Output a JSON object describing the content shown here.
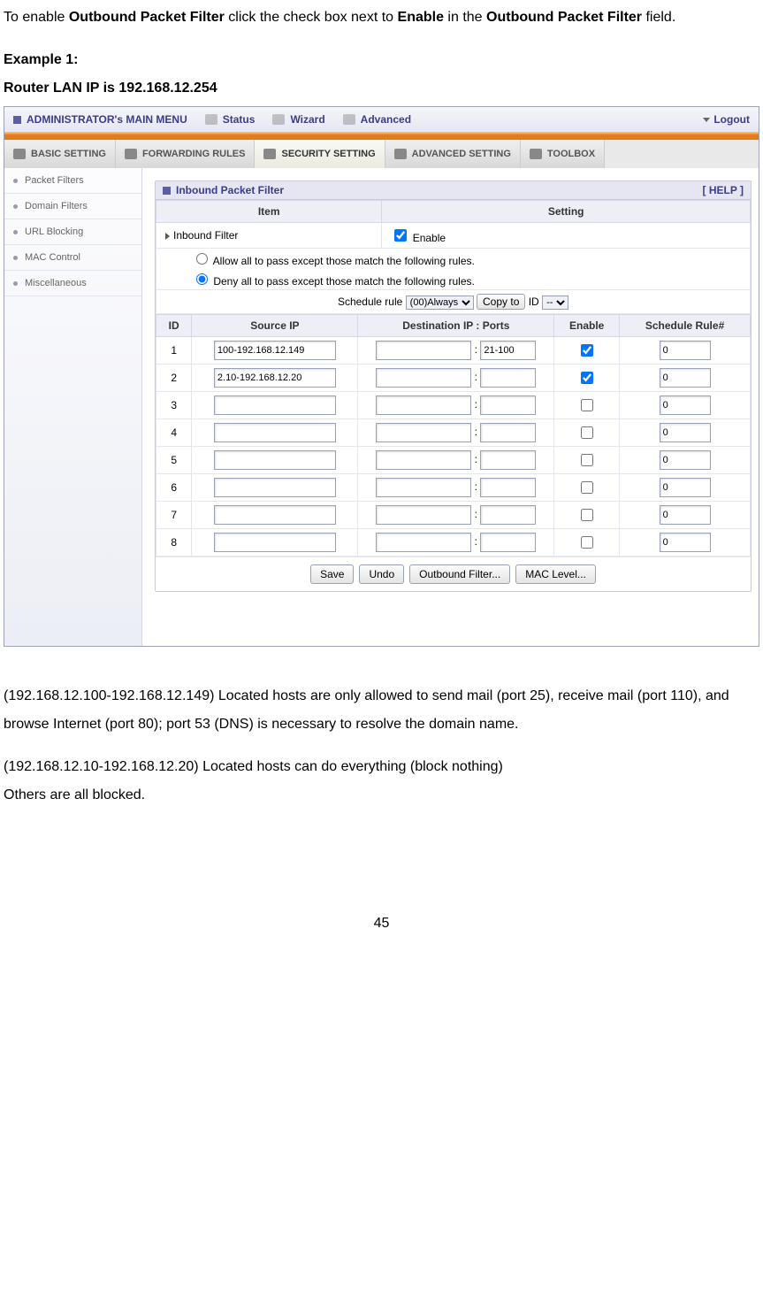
{
  "intro": {
    "prefix": "To enable ",
    "bold1": "Outbound Packet Filter",
    "mid1": " click the check box next to ",
    "bold2": "Enable",
    "mid2": " in the ",
    "bold3": "Outbound Packet Filter",
    "suffix": " field."
  },
  "heading": {
    "example_label": "Example 1:",
    "router_line": "Router LAN IP is 192.168.12.254"
  },
  "topnav": {
    "main": "ADMINISTRATOR's MAIN MENU",
    "status": "Status",
    "wizard": "Wizard",
    "advanced": "Advanced",
    "logout": "Logout"
  },
  "tabs": {
    "basic": "BASIC SETTING",
    "forwarding": "FORWARDING RULES",
    "security": "SECURITY SETTING",
    "advanced": "ADVANCED SETTING",
    "toolbox": "TOOLBOX"
  },
  "sidebar": {
    "items": [
      {
        "label": "Packet Filters"
      },
      {
        "label": "Domain Filters"
      },
      {
        "label": "URL Blocking"
      },
      {
        "label": "MAC Control"
      },
      {
        "label": "Miscellaneous"
      }
    ]
  },
  "panel": {
    "title": "Inbound Packet Filter",
    "help": "[ HELP ]",
    "th_item": "Item",
    "th_setting": "Setting",
    "row_inbound": "Inbound Filter",
    "enable_label": "Enable",
    "radio_allow": "Allow all to pass except those match the following rules.",
    "radio_deny": "Deny all to pass except those match the following rules.",
    "schedule_label": "Schedule rule",
    "schedule_option": "(00)Always",
    "copyto": "Copy to",
    "id_label": "ID",
    "id_option": "--",
    "th_id": "ID",
    "th_src": "Source IP",
    "th_dst": "Destination IP : Ports",
    "th_enable": "Enable",
    "th_sched": "Schedule Rule#",
    "rows": [
      {
        "id": "1",
        "src": "100-192.168.12.149",
        "dst": "",
        "ports": "21-100",
        "enable": true,
        "sched": "0"
      },
      {
        "id": "2",
        "src": "2.10-192.168.12.20",
        "dst": "",
        "ports": "",
        "enable": true,
        "sched": "0"
      },
      {
        "id": "3",
        "src": "",
        "dst": "",
        "ports": "",
        "enable": false,
        "sched": "0"
      },
      {
        "id": "4",
        "src": "",
        "dst": "",
        "ports": "",
        "enable": false,
        "sched": "0"
      },
      {
        "id": "5",
        "src": "",
        "dst": "",
        "ports": "",
        "enable": false,
        "sched": "0"
      },
      {
        "id": "6",
        "src": "",
        "dst": "",
        "ports": "",
        "enable": false,
        "sched": "0"
      },
      {
        "id": "7",
        "src": "",
        "dst": "",
        "ports": "",
        "enable": false,
        "sched": "0"
      },
      {
        "id": "8",
        "src": "",
        "dst": "",
        "ports": "",
        "enable": false,
        "sched": "0"
      }
    ],
    "btn_save": "Save",
    "btn_undo": "Undo",
    "btn_outbound": "Outbound Filter...",
    "btn_mac": "MAC Level..."
  },
  "after": {
    "p1": "(192.168.12.100-192.168.12.149) Located hosts are only allowed to send mail (port 25), receive mail (port 110), and browse Internet (port 80); port 53 (DNS) is necessary to resolve the domain name.",
    "p2": "(192.168.12.10-192.168.12.20) Located hosts can do everything (block nothing)",
    "p3": "Others are all blocked."
  },
  "pagenum": "45"
}
